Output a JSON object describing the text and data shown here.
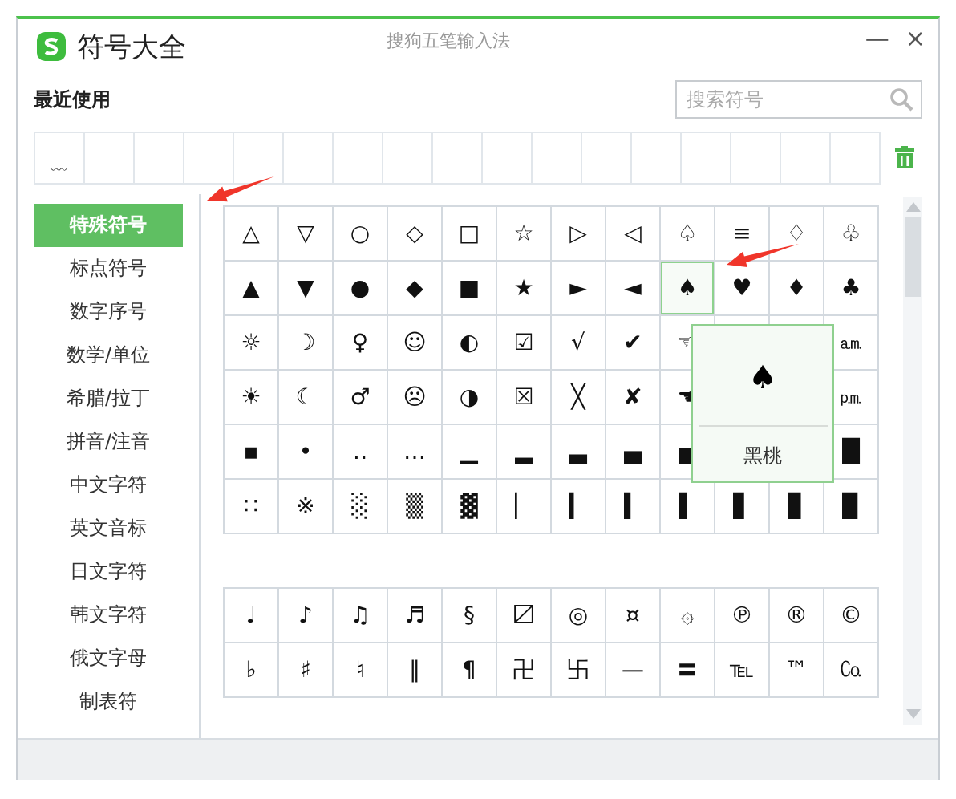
{
  "window": {
    "title": "符号大全",
    "app_name": "搜狗五笔输入法",
    "controls": [
      "—",
      "×"
    ]
  },
  "recent": {
    "label": "最近使用",
    "symbols": [
      "﹏"
    ]
  },
  "search": {
    "placeholder": "搜索符号"
  },
  "sidebar": {
    "items": [
      {
        "label": "特殊符号",
        "selected": true
      },
      {
        "label": "标点符号",
        "selected": false
      },
      {
        "label": "数字序号",
        "selected": false
      },
      {
        "label": "数学/单位",
        "selected": false
      },
      {
        "label": "希腊/拉丁",
        "selected": false
      },
      {
        "label": "拼音/注音",
        "selected": false
      },
      {
        "label": "中文字符",
        "selected": false
      },
      {
        "label": "英文音标",
        "selected": false
      },
      {
        "label": "日文字符",
        "selected": false
      },
      {
        "label": "韩文字符",
        "selected": false
      },
      {
        "label": "俄文字母",
        "selected": false
      },
      {
        "label": "制表符",
        "selected": false
      }
    ]
  },
  "symbol_groups": [
    {
      "rows": [
        [
          {
            "symbol": "△",
            "selected": false
          },
          {
            "symbol": "▽",
            "selected": false
          },
          {
            "symbol": "○",
            "selected": false
          },
          {
            "symbol": "◇",
            "selected": false
          },
          {
            "symbol": "□",
            "selected": false
          },
          {
            "symbol": "☆",
            "selected": false
          },
          {
            "symbol": "▷",
            "selected": false
          },
          {
            "symbol": "◁",
            "selected": false
          },
          {
            "symbol": "♤",
            "selected": false
          },
          {
            "symbol": "≡",
            "selected": false
          },
          {
            "symbol": "♢",
            "selected": false
          },
          {
            "symbol": "♧",
            "selected": false
          }
        ],
        [
          {
            "symbol": "▲",
            "selected": false
          },
          {
            "symbol": "▼",
            "selected": false
          },
          {
            "symbol": "●",
            "selected": false
          },
          {
            "symbol": "◆",
            "selected": false
          },
          {
            "symbol": "■",
            "selected": false
          },
          {
            "symbol": "★",
            "selected": false
          },
          {
            "symbol": "►",
            "selected": false
          },
          {
            "symbol": "◄",
            "selected": false
          },
          {
            "symbol": "♠",
            "selected": true
          },
          {
            "symbol": "♥",
            "selected": false
          },
          {
            "symbol": "♦",
            "selected": false
          },
          {
            "symbol": "♣",
            "selected": false
          }
        ],
        [
          {
            "symbol": "☼",
            "selected": false
          },
          {
            "symbol": "☽",
            "selected": false
          },
          {
            "symbol": "♀",
            "selected": false
          },
          {
            "symbol": "☺",
            "selected": false
          },
          {
            "symbol": "◐",
            "selected": false
          },
          {
            "symbol": "☑",
            "selected": false
          },
          {
            "symbol": "√",
            "selected": false
          },
          {
            "symbol": "✔",
            "selected": false
          },
          {
            "symbol": "☜",
            "selected": false
          },
          null,
          null,
          {
            "symbol": "㏂",
            "selected": false
          }
        ],
        [
          {
            "symbol": "☀",
            "selected": false
          },
          {
            "symbol": "☾",
            "selected": false
          },
          {
            "symbol": "♂",
            "selected": false
          },
          {
            "symbol": "☹",
            "selected": false
          },
          {
            "symbol": "◑",
            "selected": false
          },
          {
            "symbol": "☒",
            "selected": false
          },
          {
            "symbol": "╳",
            "selected": false
          },
          {
            "symbol": "✘",
            "selected": false
          },
          {
            "symbol": "☚",
            "selected": false
          },
          null,
          null,
          {
            "symbol": "㏘",
            "selected": false
          }
        ],
        [
          {
            "symbol": "▪",
            "selected": false
          },
          {
            "symbol": "•",
            "selected": false
          },
          {
            "symbol": "‥",
            "selected": false
          },
          {
            "symbol": "…",
            "selected": false
          },
          {
            "symbol": "▁",
            "selected": false
          },
          {
            "symbol": "▂",
            "selected": false
          },
          {
            "symbol": "▃",
            "selected": false
          },
          {
            "symbol": "▄",
            "selected": false
          },
          {
            "symbol": "▅",
            "selected": false
          },
          null,
          null,
          {
            "symbol": "█",
            "selected": false
          }
        ],
        [
          {
            "symbol": "∷",
            "selected": false
          },
          {
            "symbol": "※",
            "selected": false
          },
          {
            "symbol": "░",
            "selected": false
          },
          {
            "symbol": "▒",
            "selected": false
          },
          {
            "symbol": "▓",
            "selected": false
          },
          {
            "symbol": "▏",
            "selected": false
          },
          {
            "symbol": "▎",
            "selected": false
          },
          {
            "symbol": "▍",
            "selected": false
          },
          {
            "symbol": "▌",
            "selected": false
          },
          {
            "symbol": "▋",
            "selected": false
          },
          {
            "symbol": "▊",
            "selected": false
          },
          {
            "symbol": "▉",
            "selected": false
          }
        ]
      ]
    },
    {
      "rows": [
        [
          {
            "symbol": "♩",
            "selected": false
          },
          {
            "symbol": "♪",
            "selected": false
          },
          {
            "symbol": "♫",
            "selected": false
          },
          {
            "symbol": "♬",
            "selected": false
          },
          {
            "symbol": "§",
            "selected": false
          },
          {
            "symbol": "〼",
            "selected": false
          },
          {
            "symbol": "◎",
            "selected": false
          },
          {
            "symbol": "¤",
            "selected": false
          },
          {
            "symbol": "۞",
            "selected": false
          },
          {
            "symbol": "℗",
            "selected": false
          },
          {
            "symbol": "®",
            "selected": false
          },
          {
            "symbol": "©",
            "selected": false
          }
        ],
        [
          {
            "symbol": "♭",
            "selected": false
          },
          {
            "symbol": "♯",
            "selected": false
          },
          {
            "symbol": "♮",
            "selected": false
          },
          {
            "symbol": "‖",
            "selected": false
          },
          {
            "symbol": "¶",
            "selected": false
          },
          {
            "symbol": "卍",
            "selected": false
          },
          {
            "symbol": "卐",
            "selected": false
          },
          {
            "symbol": "—",
            "selected": false
          },
          {
            "symbol": "〓",
            "selected": false
          },
          {
            "symbol": "℡",
            "selected": false
          },
          {
            "symbol": "™",
            "selected": false
          },
          {
            "symbol": "㏇",
            "selected": false
          }
        ]
      ]
    }
  ],
  "preview": {
    "symbol": "♠",
    "name": "黑桃"
  },
  "annotations": [
    {
      "kind": "arrow"
    },
    {
      "kind": "arrow"
    }
  ]
}
